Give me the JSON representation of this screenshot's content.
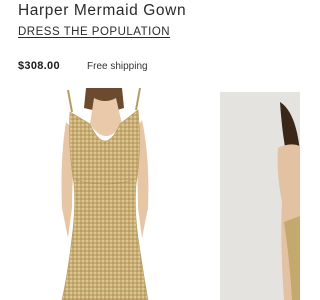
{
  "product": {
    "title": "Harper Mermaid Gown",
    "brand": "DRESS THE POPULATION",
    "price": "$308.00",
    "shipping": "Free shipping"
  },
  "colors": {
    "gown_gold": "#cbb27a",
    "text_dark": "#1a1a1a",
    "thumb_bg": "#e5e3df"
  }
}
